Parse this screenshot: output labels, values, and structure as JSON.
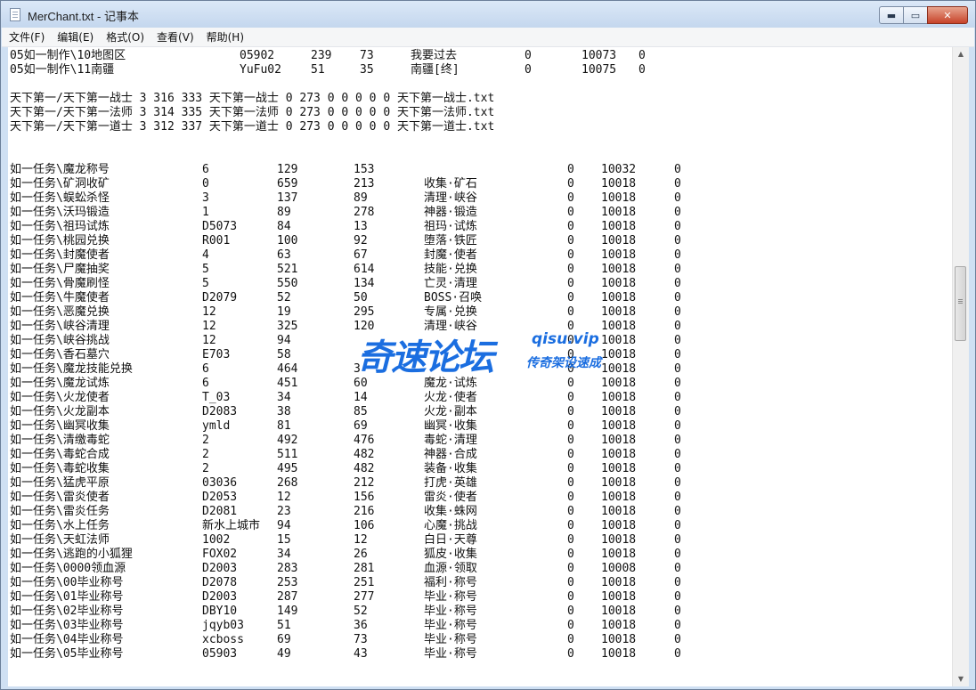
{
  "window": {
    "title": "MerChant.txt - 记事本"
  },
  "caption_buttons": {
    "minimize": "▬",
    "maximize": "▭",
    "close": "✕"
  },
  "menu": [
    {
      "label": "文件(F)"
    },
    {
      "label": "编辑(E)"
    },
    {
      "label": "格式(O)"
    },
    {
      "label": "查看(V)"
    },
    {
      "label": "帮助(H)"
    }
  ],
  "scrollbar": {
    "up_icon": "▲",
    "down_icon": "▼"
  },
  "watermark": {
    "main": "奇速论坛",
    "url": "qisu.vip",
    "sub": "传奇架设速成"
  },
  "lines_top": [
    {
      "cols": [
        "05如一制作\\10地图区",
        "05902",
        "239",
        "73",
        "我要过去",
        "0",
        "10073",
        "0"
      ]
    },
    {
      "cols": [
        "05如一制作\\11南疆",
        "YuFu02",
        "51",
        "35",
        "南疆[终]",
        "0",
        "10075",
        "0"
      ]
    }
  ],
  "lines_mid": [
    "天下第一/天下第一战士 3 316 333 天下第一战士 0 273 0 0 0 0 0 天下第一战士.txt",
    "天下第一/天下第一法师 3 314 335 天下第一法师 0 273 0 0 0 0 0 天下第一法师.txt",
    "天下第一/天下第一道士 3 312 337 天下第一道士 0 273 0 0 0 0 0 天下第一道士.txt"
  ],
  "lines_tasks": [
    [
      "如一任务\\魔龙称号",
      "6",
      "129",
      "153",
      "",
      "0",
      "10032",
      "0"
    ],
    [
      "如一任务\\矿洞收矿",
      "0",
      "659",
      "213",
      "收集·矿石",
      "0",
      "10018",
      "0"
    ],
    [
      "如一任务\\蜈蚣杀怪",
      "3",
      "137",
      "89",
      "清理·峡谷",
      "0",
      "10018",
      "0"
    ],
    [
      "如一任务\\沃玛锻造",
      "1",
      "89",
      "278",
      "神器·锻造",
      "0",
      "10018",
      "0"
    ],
    [
      "如一任务\\祖玛试炼",
      "D5073",
      "84",
      "13",
      "祖玛·试炼",
      "0",
      "10018",
      "0"
    ],
    [
      "如一任务\\桃园兑换",
      "R001",
      "100",
      "92",
      "堕落·铁匠",
      "0",
      "10018",
      "0"
    ],
    [
      "如一任务\\封魔使者",
      "4",
      "63",
      "67",
      "封魔·使者",
      "0",
      "10018",
      "0"
    ],
    [
      "如一任务\\尸魔抽奖",
      "5",
      "521",
      "614",
      "技能·兑换",
      "0",
      "10018",
      "0"
    ],
    [
      "如一任务\\骨魔刷怪",
      "5",
      "550",
      "134",
      "亡灵·清理",
      "0",
      "10018",
      "0"
    ],
    [
      "如一任务\\牛魔使者",
      "D2079",
      "52",
      "50",
      "BOSS·召唤",
      "0",
      "10018",
      "0"
    ],
    [
      "如一任务\\恶魔兑换",
      "12",
      "19",
      "295",
      "专属·兑换",
      "0",
      "10018",
      "0"
    ],
    [
      "如一任务\\峡谷清理",
      "12",
      "325",
      "120",
      "清理·峡谷",
      "0",
      "10018",
      "0"
    ],
    [
      "如一任务\\峡谷挑战",
      "12",
      "94",
      "",
      "",
      "0",
      "10018",
      "0"
    ],
    [
      "如一任务\\香石墓穴",
      "E703",
      "58",
      "",
      "",
      "0",
      "10018",
      "0"
    ],
    [
      "如一任务\\魔龙技能兑换",
      "6",
      "464",
      "3",
      "",
      "0",
      "10018",
      "0"
    ],
    [
      "如一任务\\魔龙试炼",
      "6",
      "451",
      "60",
      "魔龙·试炼",
      "0",
      "10018",
      "0"
    ],
    [
      "如一任务\\火龙使者",
      "T_03",
      "34",
      "14",
      "火龙·使者",
      "0",
      "10018",
      "0"
    ],
    [
      "如一任务\\火龙副本",
      "D2083",
      "38",
      "85",
      "火龙·副本",
      "0",
      "10018",
      "0"
    ],
    [
      "如一任务\\幽冥收集",
      "ymld",
      "81",
      "69",
      "幽冥·收集",
      "0",
      "10018",
      "0"
    ],
    [
      "如一任务\\清缴毒蛇",
      "2",
      "492",
      "476",
      "毒蛇·清理",
      "0",
      "10018",
      "0"
    ],
    [
      "如一任务\\毒蛇合成",
      "2",
      "511",
      "482",
      "神器·合成",
      "0",
      "10018",
      "0"
    ],
    [
      "如一任务\\毒蛇收集",
      "2",
      "495",
      "482",
      "装备·收集",
      "0",
      "10018",
      "0"
    ],
    [
      "如一任务\\猛虎平原",
      "03036",
      "268",
      "212",
      "打虎·英雄",
      "0",
      "10018",
      "0"
    ],
    [
      "如一任务\\雷炎使者",
      "D2053",
      "12",
      "156",
      "雷炎·使者",
      "0",
      "10018",
      "0"
    ],
    [
      "如一任务\\雷炎任务",
      "D2081",
      "23",
      "216",
      "收集·蛛网",
      "0",
      "10018",
      "0"
    ],
    [
      "如一任务\\水上任务",
      "新水上城市",
      "94",
      "106",
      "心魔·挑战",
      "0",
      "10018",
      "0"
    ],
    [
      "如一任务\\天虹法师",
      "1002",
      "15",
      "12",
      "白日·天尊",
      "0",
      "10018",
      "0"
    ],
    [
      "如一任务\\逃跑的小狐狸",
      "FOX02",
      "34",
      "26",
      "狐皮·收集",
      "0",
      "10018",
      "0"
    ],
    [
      "如一任务\\0000领血源",
      "D2003",
      "283",
      "281",
      "血源·领取",
      "0",
      "10008",
      "0"
    ],
    [
      "如一任务\\00毕业称号",
      "D2078",
      "253",
      "251",
      "福利·称号",
      "0",
      "10018",
      "0"
    ],
    [
      "如一任务\\01毕业称号",
      "D2003",
      "287",
      "277",
      "毕业·称号",
      "0",
      "10018",
      "0"
    ],
    [
      "如一任务\\02毕业称号",
      "DBY10",
      "149",
      "52",
      "毕业·称号",
      "0",
      "10018",
      "0"
    ],
    [
      "如一任务\\03毕业称号",
      "jqyb03",
      "51",
      "36",
      "毕业·称号",
      "0",
      "10018",
      "0"
    ],
    [
      "如一任务\\04毕业称号",
      "xcboss",
      "69",
      "73",
      "毕业·称号",
      "0",
      "10018",
      "0"
    ],
    [
      "如一任务\\05毕业称号",
      "05903",
      "49",
      "43",
      "毕业·称号",
      "0",
      "10018",
      "0"
    ]
  ]
}
